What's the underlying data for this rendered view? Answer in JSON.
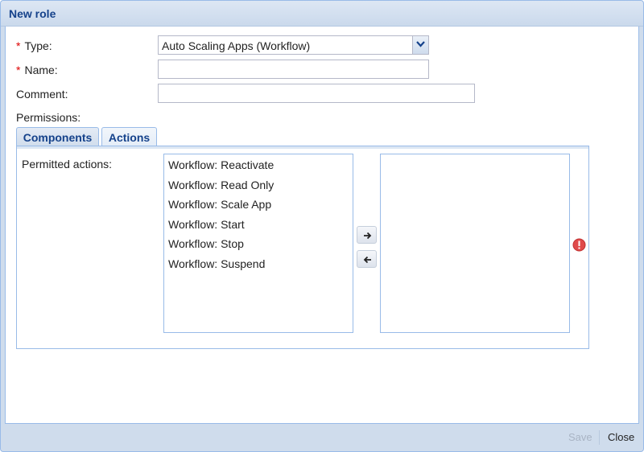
{
  "window": {
    "title": "New role"
  },
  "form": {
    "type_label": "Type:",
    "type_value": "Auto Scaling Apps (Workflow)",
    "name_label": "Name:",
    "name_value": "",
    "comment_label": "Comment:",
    "comment_value": "",
    "permissions_label": "Permissions:",
    "required_marker": "*"
  },
  "tabs": [
    {
      "label": "Components",
      "active": false
    },
    {
      "label": "Actions",
      "active": true
    }
  ],
  "actions_panel": {
    "permitted_label": "Permitted actions:",
    "available": [
      "Workflow: Reactivate",
      "Workflow: Read Only",
      "Workflow: Scale App",
      "Workflow: Start",
      "Workflow: Stop",
      "Workflow: Suspend"
    ],
    "selected": []
  },
  "icons": {
    "combo": "chevron-down-icon",
    "add": "arrow-right-icon",
    "remove": "arrow-left-icon",
    "error": "error-icon"
  },
  "colors": {
    "title_text": "#15428b",
    "required": "#dd0000",
    "error": "#e04b4b",
    "border": "#99bbe8"
  },
  "footer": {
    "save_label": "Save",
    "close_label": "Close",
    "save_enabled": false
  }
}
